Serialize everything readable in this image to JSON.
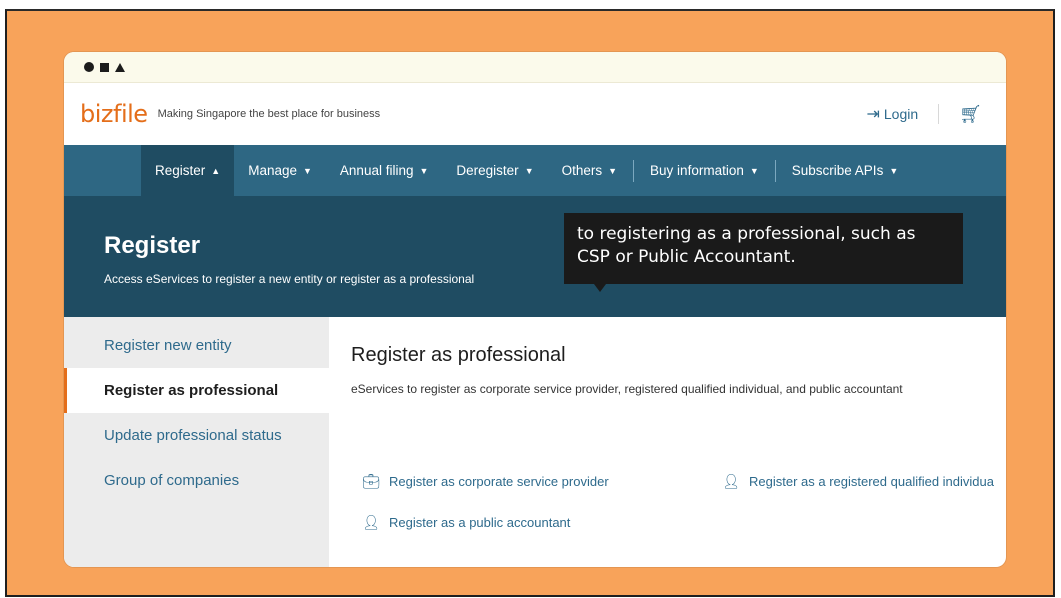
{
  "brand": {
    "logo": "bizfile",
    "tagline": "Making Singapore the best place for business"
  },
  "header": {
    "login_label": "Login"
  },
  "nav": {
    "items": [
      {
        "label": "Register"
      },
      {
        "label": "Manage"
      },
      {
        "label": "Annual filing"
      },
      {
        "label": "Deregister"
      },
      {
        "label": "Others"
      },
      {
        "label": "Buy information"
      },
      {
        "label": "Subscribe APIs"
      }
    ]
  },
  "hero": {
    "title": "Register",
    "subtitle": "Access eServices to register a new entity or register as a professional"
  },
  "caption": {
    "text": "to registering as a professional, such as CSP or Public Accountant."
  },
  "sidebar": {
    "items": [
      {
        "label": "Register new entity"
      },
      {
        "label": "Register as professional"
      },
      {
        "label": "Update professional status"
      },
      {
        "label": "Group of companies"
      }
    ]
  },
  "content": {
    "title": "Register as professional",
    "description": "eServices to register as corporate service provider, registered qualified individual, and public accountant",
    "links": [
      {
        "label": "Register as corporate service provider",
        "icon": "briefcase-icon"
      },
      {
        "label": "Register as a registered qualified individua",
        "icon": "person-add-icon"
      },
      {
        "label": "Register as a public accountant",
        "icon": "person-add-icon"
      }
    ]
  },
  "colors": {
    "accent": "#e46e1a",
    "nav": "#2e6783",
    "hero": "#1f4c62",
    "frame": "#f8a35a",
    "link": "#2e6a8c"
  }
}
